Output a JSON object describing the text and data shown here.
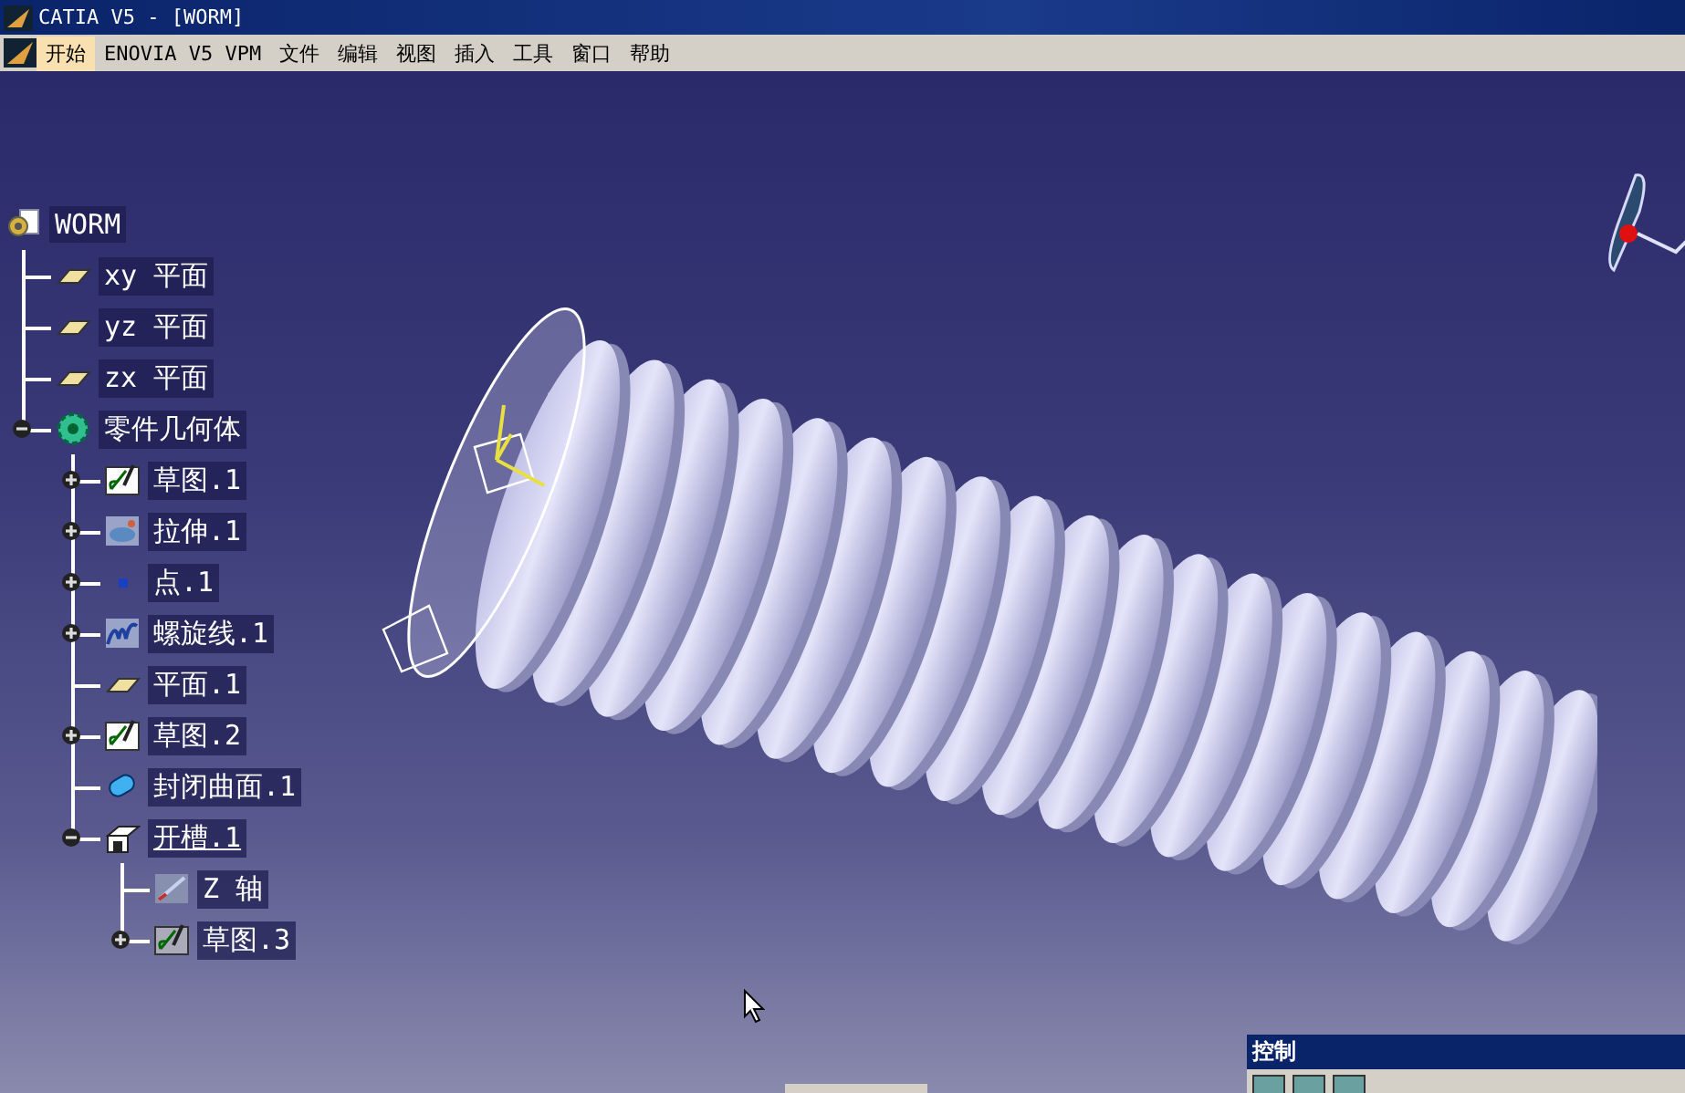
{
  "window": {
    "title": "CATIA V5 - [WORM]"
  },
  "menu": [
    {
      "label": "开始",
      "selected": true
    },
    {
      "label": "ENOVIA V5 VPM",
      "selected": false
    },
    {
      "label": "文件",
      "selected": false
    },
    {
      "label": "编辑",
      "selected": false
    },
    {
      "label": "视图",
      "selected": false
    },
    {
      "label": "插入",
      "selected": false
    },
    {
      "label": "工具",
      "selected": false
    },
    {
      "label": "窗口",
      "selected": false
    },
    {
      "label": "帮助",
      "selected": false
    }
  ],
  "tree": {
    "label": "WORM",
    "kind": "product",
    "selected": false,
    "children": [
      {
        "label": "xy 平面",
        "kind": "plane",
        "selected": false
      },
      {
        "label": "yz 平面",
        "kind": "plane",
        "selected": false
      },
      {
        "label": "zx 平面",
        "kind": "plane",
        "selected": false
      },
      {
        "label": "零件几何体",
        "kind": "body",
        "selected": false,
        "expanded": true,
        "children": [
          {
            "label": "草图.1",
            "kind": "sketch",
            "selected": false,
            "expanded": false
          },
          {
            "label": "拉伸.1",
            "kind": "extrude",
            "selected": false,
            "expanded": false
          },
          {
            "label": "点.1",
            "kind": "point",
            "selected": false,
            "expanded": false
          },
          {
            "label": "螺旋线.1",
            "kind": "helix",
            "selected": false,
            "expanded": false
          },
          {
            "label": "平面.1",
            "kind": "plane",
            "selected": false
          },
          {
            "label": "草图.2",
            "kind": "sketch",
            "selected": false,
            "expanded": false
          },
          {
            "label": "封闭曲面.1",
            "kind": "surface",
            "selected": false
          },
          {
            "label": "开槽.1",
            "kind": "groove",
            "selected": true,
            "expanded": true,
            "children": [
              {
                "label": "Z 轴",
                "kind": "axis",
                "selected": false
              },
              {
                "label": "草图.3",
                "kind": "sketch3",
                "selected": false,
                "expanded": false
              }
            ]
          }
        ]
      }
    ]
  },
  "control_panel": {
    "title": "控制"
  }
}
